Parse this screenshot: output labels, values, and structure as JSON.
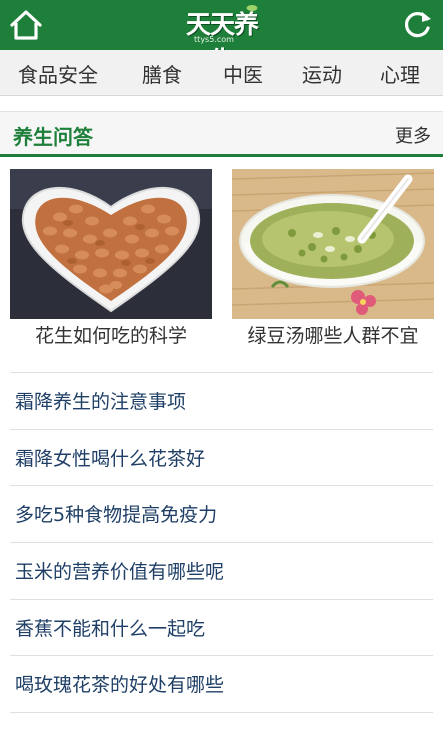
{
  "header": {
    "brand": "天天养生",
    "url": "ttys5.com",
    "home_icon": "home-icon",
    "refresh_icon": "refresh-icon",
    "background": "#1d7f3a"
  },
  "nav": {
    "items": [
      {
        "label": "食品安全"
      },
      {
        "label": "膳食"
      },
      {
        "label": "中医"
      },
      {
        "label": "运动"
      },
      {
        "label": "心理"
      }
    ]
  },
  "section": {
    "title": "养生问答",
    "more_label": "更多",
    "accent": "#1d7f3a"
  },
  "featured": [
    {
      "caption": "花生如何吃的科学",
      "image": "peanuts-heart-bowl"
    },
    {
      "caption": "绿豆汤哪些人群不宜",
      "image": "mung-bean-soup-bowl"
    }
  ],
  "articles": [
    {
      "title": "霜降养生的注意事项"
    },
    {
      "title": "霜降女性喝什么花茶好"
    },
    {
      "title": "多吃5种食物提高免疫力"
    },
    {
      "title": "玉米的营养价值有哪些呢"
    },
    {
      "title": "香蕉不能和什么一起吃"
    },
    {
      "title": "喝玫瑰花茶的好处有哪些"
    }
  ]
}
